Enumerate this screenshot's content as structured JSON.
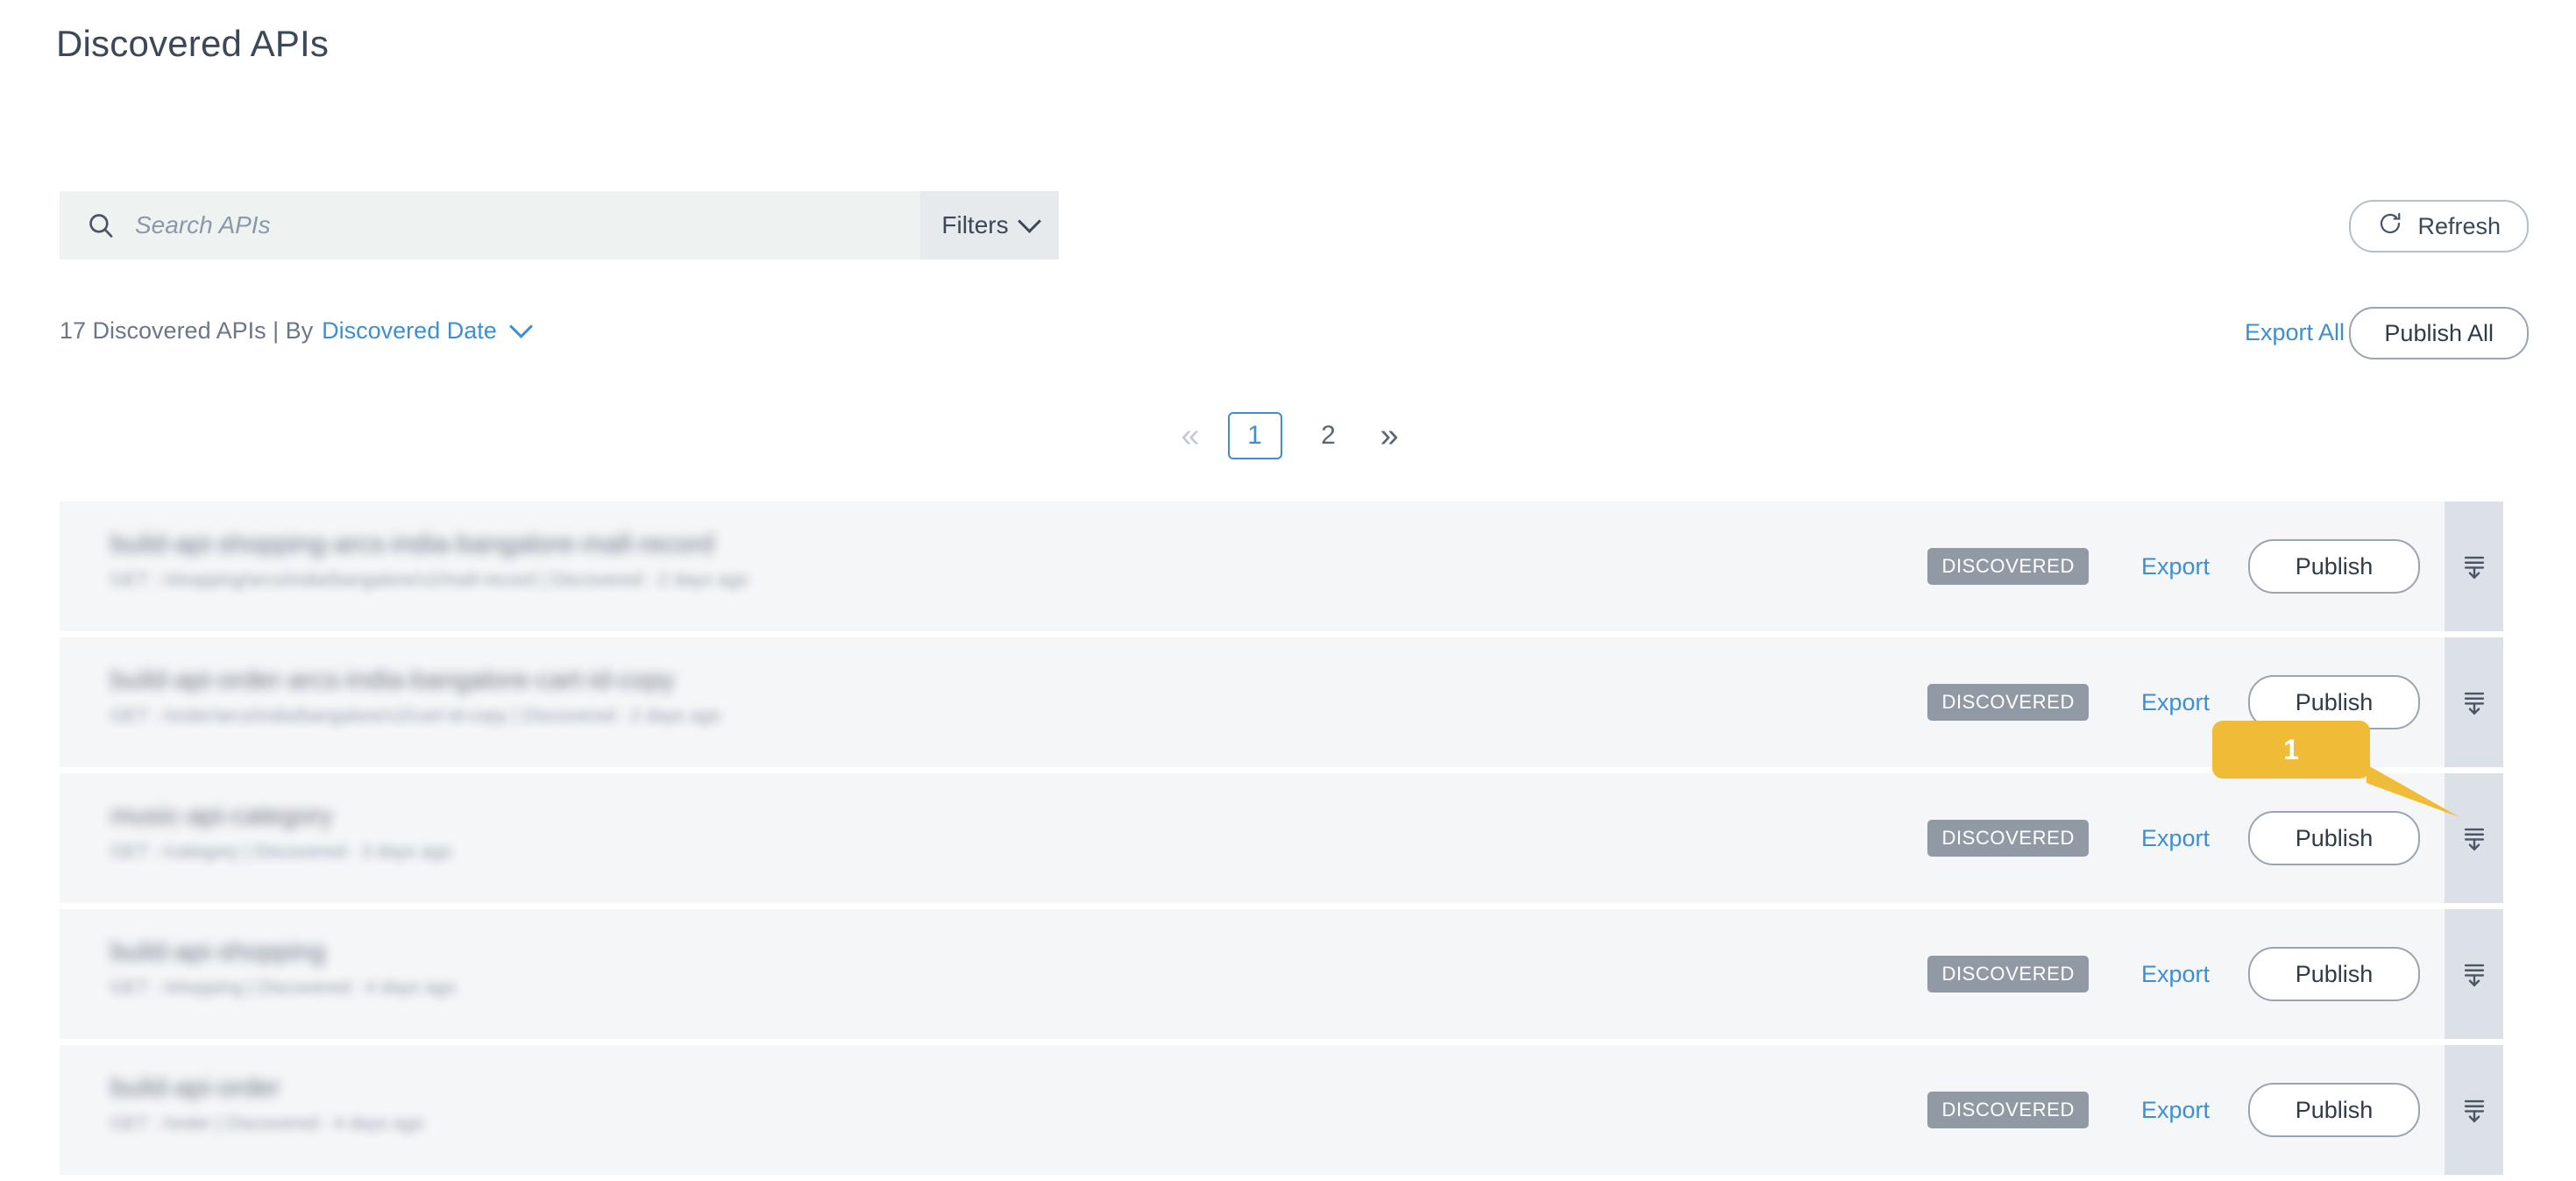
{
  "page": {
    "title": "Discovered APIs"
  },
  "search": {
    "placeholder": "Search APIs",
    "value": "",
    "icon": "search-icon",
    "filters_label": "Filters",
    "filters_icon": "chevron-down-icon"
  },
  "toolbar": {
    "refresh_label": "Refresh",
    "refresh_icon": "refresh-icon"
  },
  "meta": {
    "count_text": "17 Discovered APIs | By",
    "sort_label": "Discovered Date",
    "sort_icon": "chevron-down-icon",
    "export_all_label": "Export All",
    "publish_all_label": "Publish All"
  },
  "pagination": {
    "first_icon": "double-chevron-left-icon",
    "first_label": "«",
    "last_icon": "double-chevron-right-icon",
    "last_label": "»",
    "pages": [
      "1",
      "2"
    ],
    "active_page": "1"
  },
  "rows": [
    {
      "name_blurred": "build-api-shopping-arcs-india-bangalore-mall-record",
      "subtitle_blurred": "GET : /shopping/arcs/india/bangalore/v2/mall-record  |  Discovered : 2 days ago",
      "status": "DISCOVERED",
      "export_label": "Export",
      "publish_label": "Publish",
      "expand_icon": "collapse-down-icon"
    },
    {
      "name_blurred": "build-api-order-arcs-india-bangalore-cart-id-copy",
      "subtitle_blurred": "GET : /order/arcs/india/bangalore/v2/cart-id-copy  |  Discovered : 2 days ago",
      "status": "DISCOVERED",
      "export_label": "Export",
      "publish_label": "Publish",
      "expand_icon": "collapse-down-icon"
    },
    {
      "name_blurred": "music-api-category",
      "subtitle_blurred": "GET : /category  |  Discovered : 3 days ago",
      "status": "DISCOVERED",
      "export_label": "Export",
      "publish_label": "Publish",
      "expand_icon": "collapse-down-icon"
    },
    {
      "name_blurred": "build-api-shopping",
      "subtitle_blurred": "GET : /shopping  |  Discovered : 4 days ago",
      "status": "DISCOVERED",
      "export_label": "Export",
      "publish_label": "Publish",
      "expand_icon": "collapse-down-icon"
    },
    {
      "name_blurred": "build-api-order",
      "subtitle_blurred": "GET : /order  |  Discovered : 4 days ago",
      "status": "DISCOVERED",
      "export_label": "Export",
      "publish_label": "Publish",
      "expand_icon": "collapse-down-icon"
    }
  ],
  "callout": {
    "number": "1",
    "color": "#f0bc37"
  },
  "colors": {
    "accent_blue": "#3d8fd1",
    "text_dark": "#3c4858",
    "row_bg": "#f4f6f8",
    "expand_col_bg": "#dce1e7",
    "badge_gray": "#919aa4",
    "search_bg": "#eef3f2",
    "filters_bg": "#e6eaed",
    "callout_orange": "#f0bc37"
  }
}
